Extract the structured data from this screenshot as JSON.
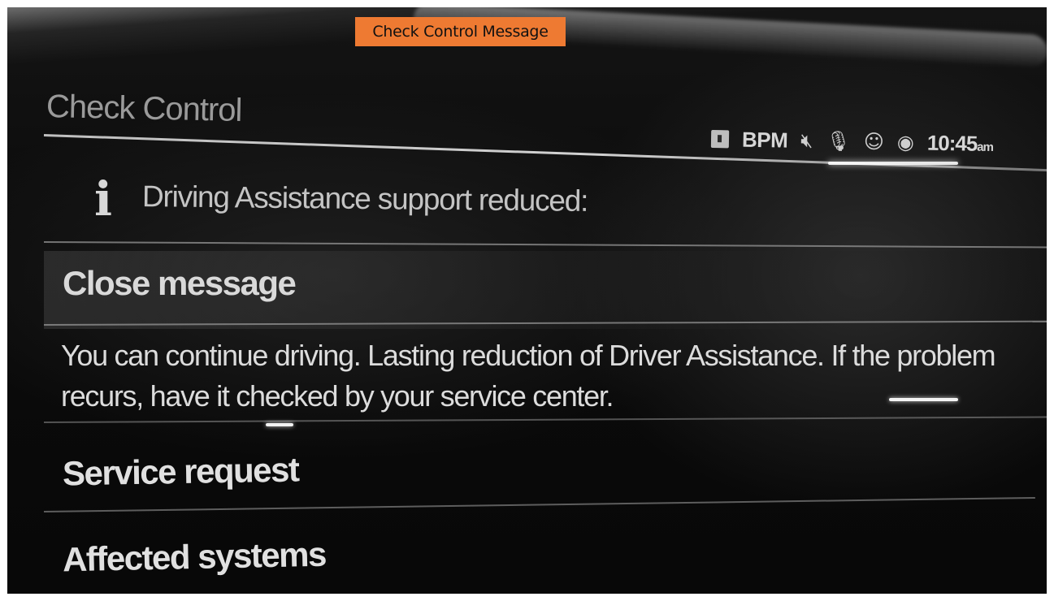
{
  "caption": "Check Control Message",
  "screen": {
    "title": "Check Control"
  },
  "status_bar": {
    "media_icon": "media-source-icon",
    "mode": "BPM",
    "mute_icon": "mute-icon",
    "mic_icon": "microphone-icon",
    "profile_icon": "profile-icon",
    "connectivity_icon": "connectivity-icon",
    "time": "10:45",
    "time_suffix": "am"
  },
  "notice": {
    "icon": "info-icon",
    "text": "Driving Assistance support reduced:"
  },
  "menu": {
    "close_message": "Close message",
    "message_body": "You can continue driving. Lasting reduction of Driver Assistance. If the problem recurs, have it checked by your service center.",
    "service_request": "Service request",
    "affected_systems": "Affected systems"
  },
  "colors": {
    "caption_background": "#ee7a32",
    "screen_background": "#0b0b0b",
    "text_primary": "#e0e0e0",
    "title_text": "#9a9a9a"
  }
}
